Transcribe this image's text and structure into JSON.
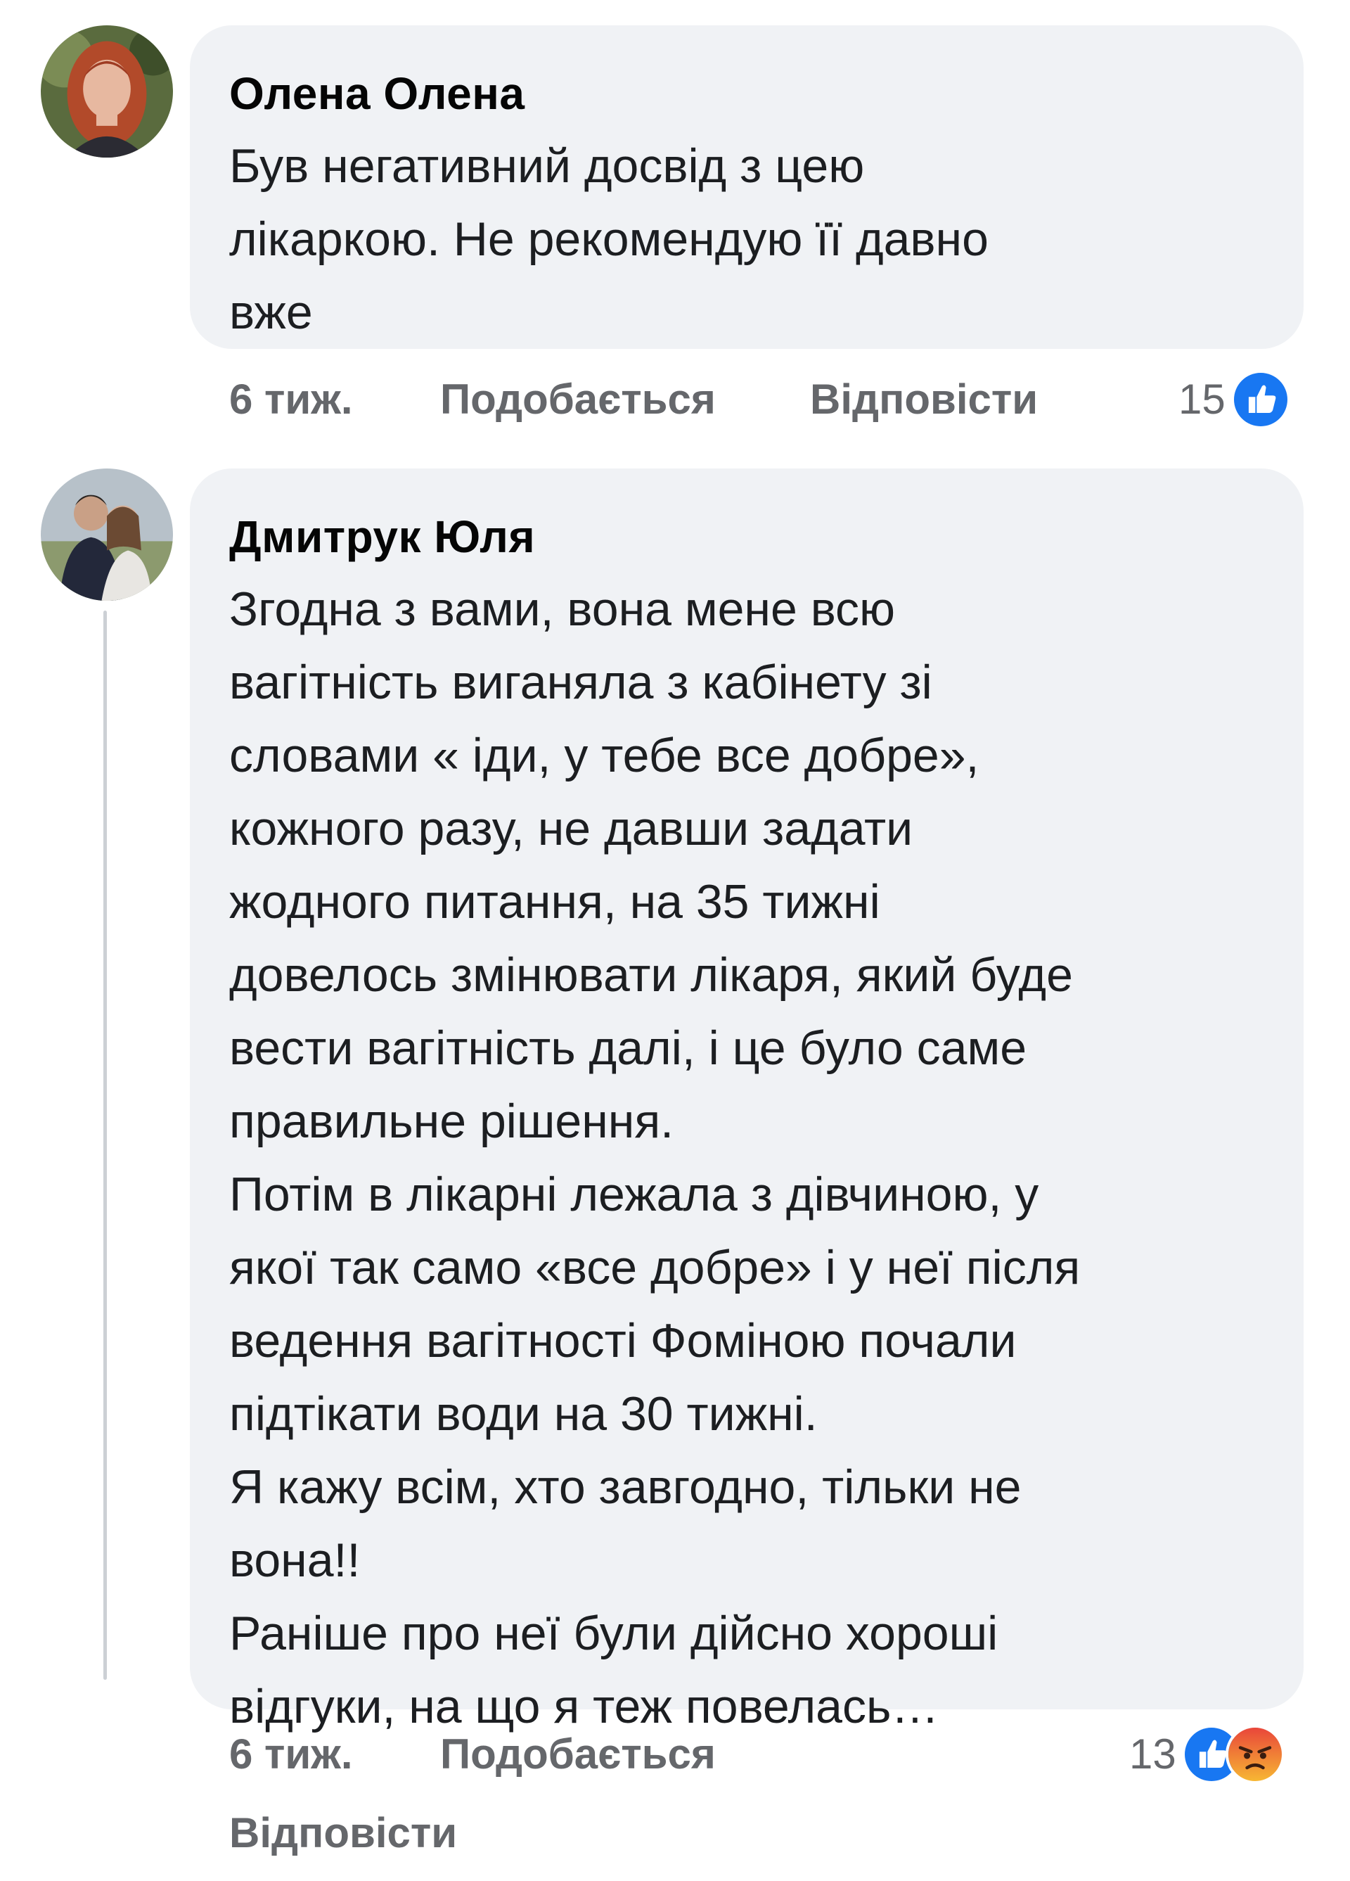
{
  "comments": [
    {
      "author": "Олена Олена",
      "text": "Був негативний досвід з цею\nлікаркою. Не рекомендую її давно\nвже",
      "time": "6 тиж.",
      "like_label": "Подобається",
      "reply_label": "Відповісти",
      "reaction_count": "15",
      "reactions": [
        "like-icon"
      ]
    },
    {
      "author": "Дмитрук Юля",
      "text": "Згодна з вами, вона мене всю\nвагітність виганяла з кабінету зі\nсловами « іди, у тебе все добре»,\nкожного разу, не давши задати\nжодного питання, на 35 тижні\nдовелось змінювати лікаря, який буде\nвести вагітність далі, і це було саме\nправильне рішення.\nПотім в лікарні лежала з дівчиною, у\nякої так само «все добре» і у неї після\nведення вагітності Фоміною почали\nпідтікати води на 30 тижні.\nЯ кажу всім, хто завгодно, тільки не\nвона!!\nРаніше про неї були дійсно хороші\nвідгуки, на що я теж повелась…",
      "time": "6 тиж.",
      "like_label": "Подобається",
      "reply_label": "Відповісти",
      "reaction_count": "13",
      "reactions": [
        "like-icon",
        "angry-icon"
      ]
    }
  ],
  "colors": {
    "bubble": "#f0f2f5",
    "meta_text": "#65676b",
    "like_blue": "#1877f2",
    "angry_orange": "#f0653a"
  }
}
